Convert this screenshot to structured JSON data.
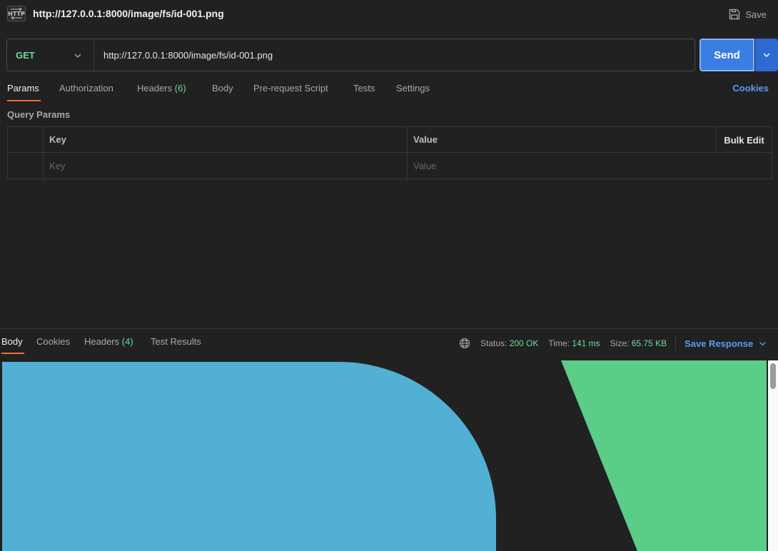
{
  "window": {
    "title": "http://127.0.0.1:8000/image/fs/id-001.png",
    "save_label": "Save"
  },
  "request": {
    "method": "GET",
    "url": "http://127.0.0.1:8000/image/fs/id-001.png",
    "send_label": "Send"
  },
  "tabs": {
    "params": "Params",
    "authorization": "Authorization",
    "headers": "Headers",
    "headers_count": "(6)",
    "body": "Body",
    "prerequest": "Pre-request Script",
    "tests": "Tests",
    "settings": "Settings",
    "cookies": "Cookies"
  },
  "query_params": {
    "label": "Query Params",
    "col_key": "Key",
    "col_value": "Value",
    "bulk_edit": "Bulk Edit",
    "key_placeholder": "Key",
    "value_placeholder": "Value"
  },
  "response": {
    "tabs": {
      "body": "Body",
      "cookies": "Cookies",
      "headers": "Headers",
      "headers_count": "(4)",
      "test_results": "Test Results"
    },
    "status_label": "Status:",
    "status_value": "200 OK",
    "time_label": "Time:",
    "time_value": "141 ms",
    "size_label": "Size:",
    "size_value": "65.75 KB",
    "save_response": "Save Response"
  },
  "colors": {
    "accent": "#3a7de3",
    "method_get": "#6bdd9a",
    "link": "#5b9cf3",
    "tab_underline": "#f26b3a",
    "preview_blue": "#51b0d3",
    "preview_green": "#5ccd89"
  }
}
